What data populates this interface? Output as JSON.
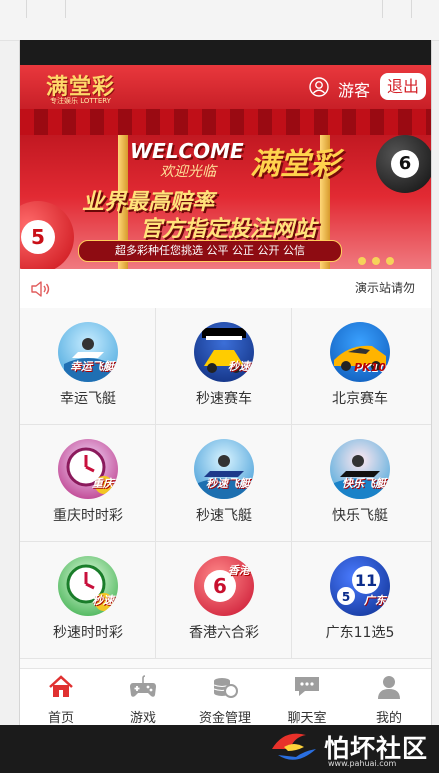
{
  "app": {
    "logo_title": "满堂彩",
    "logo_sub": "专注娱乐 LOTTERY",
    "guest_label": "游客",
    "logout_label": "退出"
  },
  "banner": {
    "welcome": "WELCOME",
    "welcome_cn": "欢迎光临",
    "brand": "满堂彩",
    "line1": "业界最高赔率",
    "line2": "官方指定投注网站",
    "slogan": "超多彩种任您挑选 公平 公正 公开 公信",
    "ball_left": "5",
    "ball_right": "6"
  },
  "notice": {
    "text": "演示站请勿"
  },
  "games": [
    {
      "label": "幸运飞艇",
      "tag": "幸运飞艇",
      "icon": "boat-icon"
    },
    {
      "label": "秒速赛车",
      "tag": "秒速",
      "icon": "racecar-icon"
    },
    {
      "label": "北京赛车",
      "tag": "PK10",
      "icon": "sportscar-icon"
    },
    {
      "label": "重庆时时彩",
      "tag": "重庆",
      "icon": "clock-icon"
    },
    {
      "label": "秒速飞艇",
      "tag": "秒速飞艇",
      "icon": "jetski-icon"
    },
    {
      "label": "快乐飞艇",
      "tag": "快乐飞艇",
      "icon": "jetski-icon"
    },
    {
      "label": "秒速时时彩",
      "tag": "秒速",
      "icon": "clock-icon"
    },
    {
      "label": "香港六合彩",
      "tag": "香港",
      "icon": "lottery-ball-icon",
      "num": "6"
    },
    {
      "label": "广东11选5",
      "tag": "广东",
      "icon": "lottery-ball-icon",
      "num": "11",
      "num2": "5"
    }
  ],
  "tabs": [
    {
      "label": "首页",
      "icon": "home-icon"
    },
    {
      "label": "游戏",
      "icon": "gamepad-icon"
    },
    {
      "label": "资金管理",
      "icon": "coins-icon"
    },
    {
      "label": "聊天室",
      "icon": "chat-icon"
    },
    {
      "label": "我的",
      "icon": "user-icon"
    }
  ],
  "watermark": {
    "text": "怕坏社区",
    "url": "www.pahuai.com"
  },
  "colors": {
    "brand_red": "#d4232a",
    "active_tab": "#e03131",
    "inactive_tab": "#9e9e9e"
  }
}
